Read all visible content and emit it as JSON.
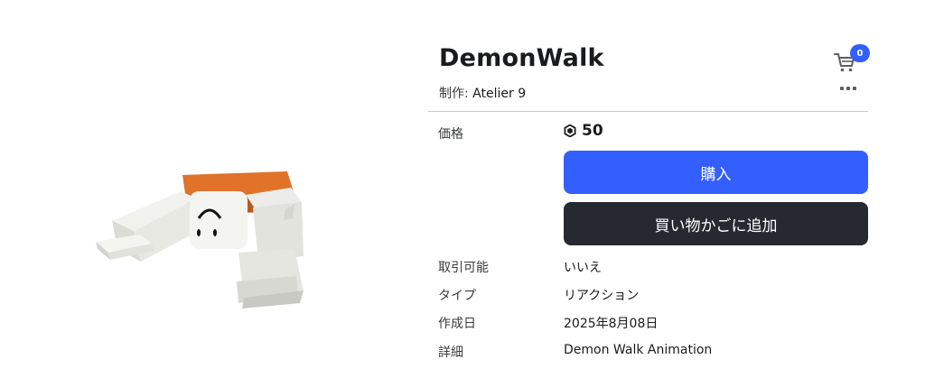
{
  "item": {
    "name": "DemonWalk",
    "creator_prefix": "制作: ",
    "creator_name": "Atelier 9"
  },
  "cart": {
    "count": "0"
  },
  "price": {
    "label": "価格",
    "amount": "50"
  },
  "buttons": {
    "buy": "購入",
    "add_to_cart": "買い物かごに追加"
  },
  "details": {
    "resellable_label": "取引可能",
    "resellable_value": "いいえ",
    "type_label": "タイプ",
    "type_value": "リアクション",
    "created_label": "作成日",
    "created_value": "2025年8月08日",
    "description_label": "詳細",
    "description_value": "Demon Walk Animation"
  },
  "colors": {
    "accent": "#335fff",
    "dark_button": "#272930"
  }
}
